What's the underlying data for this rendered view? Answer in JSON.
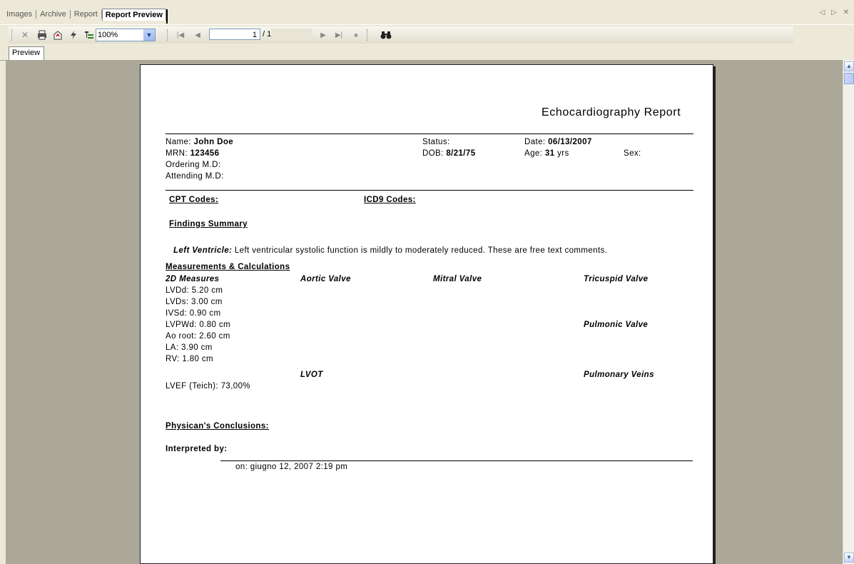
{
  "tabs": [
    "Images",
    "Archive",
    "Report",
    "Report Preview"
  ],
  "tab_nav": "◁ ▷ ✕",
  "toolbar": {
    "zoom": "100%",
    "page_current": "1",
    "page_total": "/ 1"
  },
  "subtab": "Preview",
  "report": {
    "title": "Echocardiography Report",
    "name_label": "Name:",
    "name_value": "John Doe",
    "mrn_label": "MRN:",
    "mrn_value": "123456",
    "ordering_label": "Ordering M.D:",
    "attending_label": "Attending M.D:",
    "status_label": "Status:",
    "dob_label": "DOB:",
    "dob_value": "8/21/75",
    "date_label": "Date:",
    "date_value": "06/13/2007",
    "age_label": "Age:",
    "age_value": "31",
    "age_unit": "yrs",
    "sex_label": "Sex:",
    "cpt_codes": "CPT Codes:",
    "icd9_codes": "ICD9 Codes:",
    "findings_summary": "Findings Summary",
    "lv_label": "Left Ventricle:",
    "lv_text": "Left ventricular systolic function is mildly to moderately reduced. These are free text comments.",
    "measurements_title": "Measurements & Calculations",
    "col_2d": "2D Measures",
    "col_aortic": "Aortic Valve",
    "col_mitral": "Mitral Valve",
    "col_tricuspid": "Tricuspid Valve",
    "measures": [
      "LVDd: 5.20  cm",
      "LVDs: 3.00 cm",
      "IVSd: 0.90 cm",
      "LVPWd: 0.80 cm",
      "Ao root: 2.60 cm",
      "LA: 3.90 cm",
      "RV: 1.80  cm"
    ],
    "pulmonic_valve": "Pulmonic Valve",
    "lvot": "LVOT",
    "pulmonary_veins": "Pulmonary Veins",
    "lvef": "LVEF (Teich): 73,00%",
    "conclusions": "Physican's Conclusions:",
    "interpreted_by": "Interpreted by:",
    "signed_on": "on: giugno 12, 2007  2:19 pm"
  }
}
